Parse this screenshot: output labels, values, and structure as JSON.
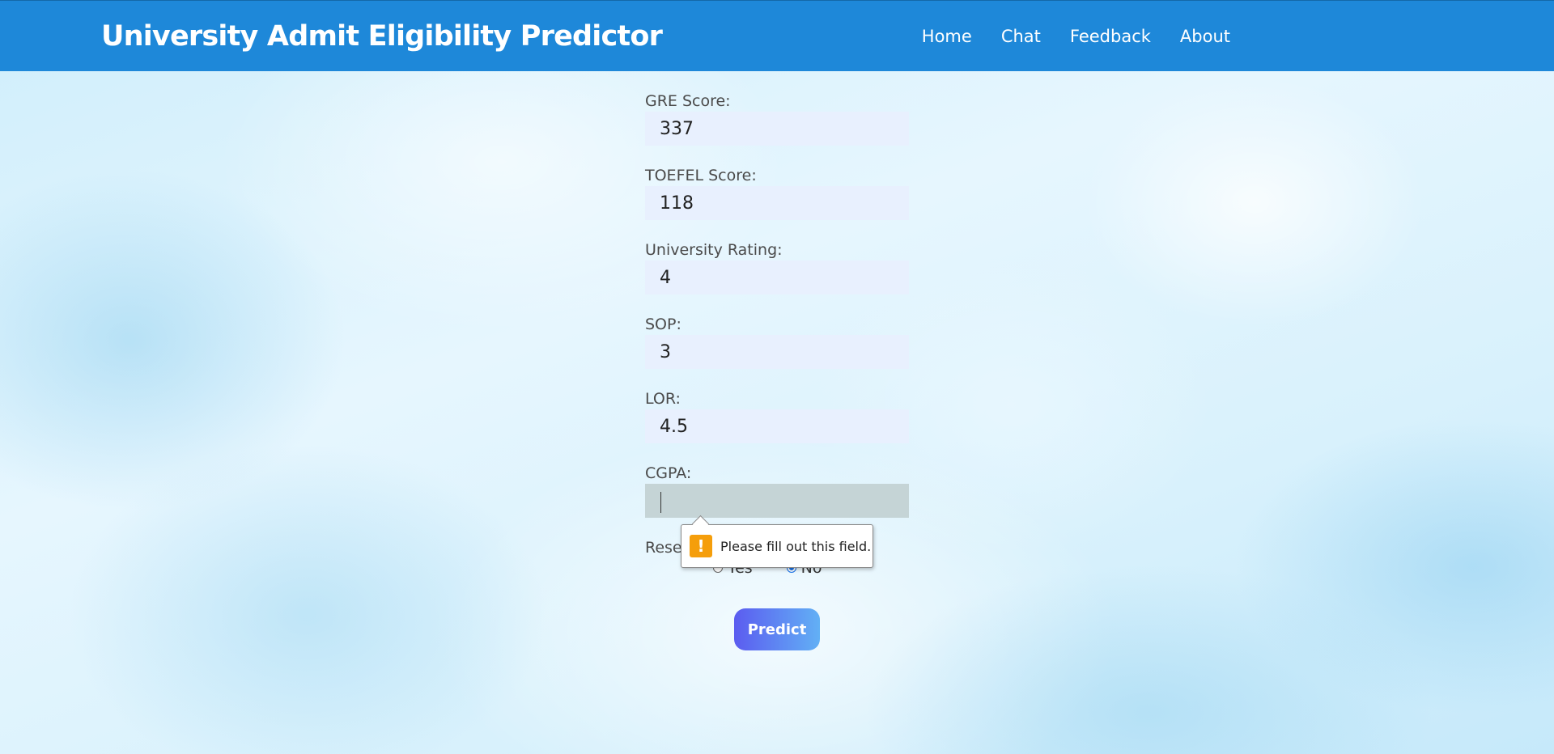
{
  "navbar": {
    "brand": "University Admit Eligibility Predictor",
    "links": [
      "Home",
      "Chat",
      "Feedback",
      "About"
    ]
  },
  "form": {
    "fields": [
      {
        "label": "GRE Score:",
        "value": "337"
      },
      {
        "label": "TOEFEL Score:",
        "value": "118"
      },
      {
        "label": "University Rating:",
        "value": "4"
      },
      {
        "label": "SOP:",
        "value": "3"
      },
      {
        "label": "LOR:",
        "value": "4.5"
      },
      {
        "label": "CGPA:",
        "value": ""
      }
    ],
    "research": {
      "label": "Rese",
      "options": [
        "Yes",
        "No"
      ],
      "selected": "No"
    },
    "validation_message": "Please fill out this field.",
    "submit_label": "Predict"
  },
  "colors": {
    "navbar": "#1e88d9",
    "input_bg": "#e8f0fe",
    "focused_input_bg": "#c5d4d6",
    "warning": "#f59e0b"
  }
}
